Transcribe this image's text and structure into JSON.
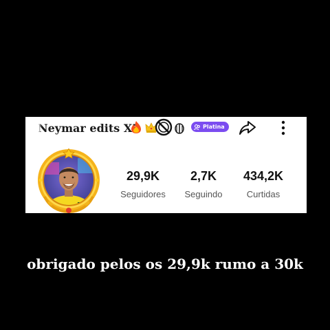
{
  "profile": {
    "username": "Neymar edits X7",
    "badge_label": "Platina",
    "badge_color": "#7b4cf0",
    "icons": [
      "fire-emoji",
      "crown-emoji",
      "prohibited-ball-emoji",
      "rooster-emoji",
      "share-icon",
      "more-vert-icon"
    ]
  },
  "stats": [
    {
      "value": "29,9K",
      "label": "Seguidores"
    },
    {
      "value": "2,7K",
      "label": "Seguindo"
    },
    {
      "value": "434,2K",
      "label": "Curtidas"
    }
  ],
  "caption": "obrigado pelos os 29,9k rumo a 30k"
}
